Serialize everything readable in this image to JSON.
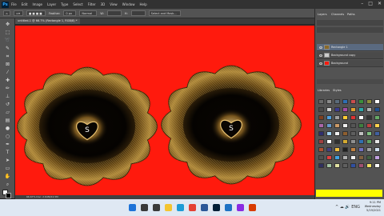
{
  "app": {
    "logo_text": "Ps",
    "menus": [
      "File",
      "Edit",
      "Image",
      "Layer",
      "Type",
      "Select",
      "Filter",
      "3D",
      "View",
      "Window",
      "Help"
    ],
    "window_controls": [
      "–",
      "□",
      "✕"
    ]
  },
  "options_bar": {
    "feather_label": "Feather:",
    "feather_value": "0 px",
    "style_value": "Normal",
    "width_label": "W:",
    "height_label": "H:",
    "refine_label": "Select and Mask..."
  },
  "document": {
    "tab_label": "untitled-1 @ 66.7% (Rectangle 1, RGB/8) *",
    "status_text": "66.67%   Doc: 2.64M/24.5M",
    "background_color": "#ff1a0d",
    "left_heart_letter": "S",
    "right_heart_letter": "S"
  },
  "panels": {
    "tabs_top": [
      "Layers",
      "Channels",
      "Paths"
    ],
    "tabs_mid": [
      "Libraries",
      "Styles"
    ],
    "layers": [
      {
        "name": "Rectangle 1",
        "thumb": "#8a6a2a"
      },
      {
        "name": "Background copy",
        "thumb": "#cccccc"
      },
      {
        "name": "Background",
        "thumb": "#ff1a0d"
      }
    ],
    "swatches": [
      "#6a6a6a",
      "#8a8a8a",
      "#5b6b7b",
      "#2e6fb5",
      "#c94d4d",
      "#3b8f3b",
      "#8f8f3b",
      "#ffffff",
      "#4a4a4a",
      "#d0d0d0",
      "#3b3b8f",
      "#a64ca6",
      "#e0a030",
      "#2aa7a7",
      "#b3b3b3",
      "#1f4f8f",
      "#7f3f1f",
      "#4f9fdf",
      "#9f9f9f",
      "#ffcc33",
      "#dd3333",
      "#ffffff",
      "#333333",
      "#66aa66",
      "#aa66aa",
      "#6699cc",
      "#cc9966",
      "#eeeeee",
      "#555555",
      "#3f7f3f",
      "#bf3f3f",
      "#ffd24d",
      "#2f2f6f",
      "#9fcfef",
      "#efefef",
      "#8f5f2f",
      "#5f5f5f",
      "#c0c0c0",
      "#7fbf7f",
      "#4060a0",
      "#a04040",
      "#ffffff",
      "#303030",
      "#d4aa30",
      "#909090",
      "#3070b0",
      "#60a060",
      "#e6e6e6",
      "#b05030",
      "#404080",
      "#f0c040",
      "#202020",
      "#c08040",
      "#7070c0",
      "#a0a0a0",
      "#d0e0f0",
      "#505050",
      "#e04040",
      "#40a0e0",
      "#b0b0b0",
      "#f0f0f0",
      "#806040",
      "#406040",
      "#c0a0e0",
      "#303060",
      "#a0c0a0",
      "#e0e0a0",
      "#606060",
      "#3050a0",
      "#a05070",
      "#f0e060",
      "#ffffff"
    ]
  },
  "taskbar": {
    "time": "9:11 PM",
    "day": "Wednesday",
    "date": "5/19/2021",
    "tray": "^ ☁ 🔊 ENG",
    "icons": [
      {
        "name": "windows-icon",
        "color": "#1e73d8"
      },
      {
        "name": "search-icon",
        "color": "#3a3a3a"
      },
      {
        "name": "task-view-icon",
        "color": "#3a3a3a"
      },
      {
        "name": "file-explorer-icon",
        "color": "#f4c430"
      },
      {
        "name": "edge-icon",
        "color": "#1d9bd6"
      },
      {
        "name": "chrome-icon",
        "color": "#e44134"
      },
      {
        "name": "store-icon",
        "color": "#2b5797"
      },
      {
        "name": "photoshop-icon",
        "color": "#001e36"
      },
      {
        "name": "mail-icon",
        "color": "#1d72c4"
      },
      {
        "name": "video-icon",
        "color": "#8a2be2"
      },
      {
        "name": "music-icon",
        "color": "#d83b01"
      }
    ]
  }
}
